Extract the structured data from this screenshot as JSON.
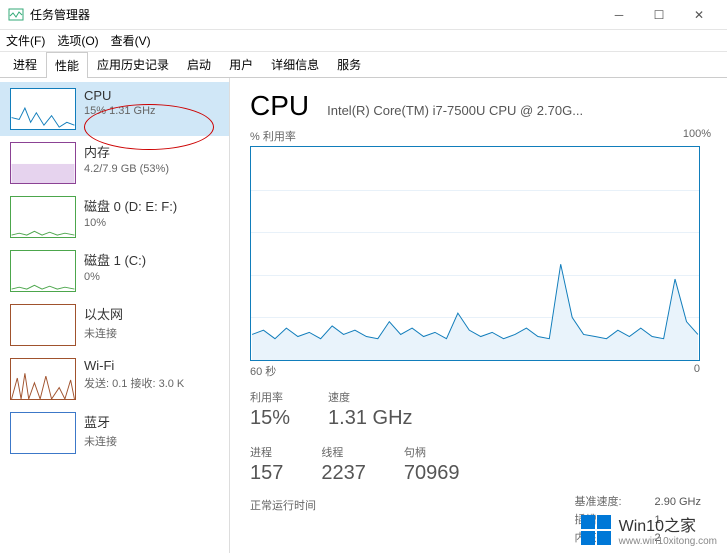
{
  "window": {
    "title": "任务管理器"
  },
  "menu": {
    "file": "文件(F)",
    "options": "选项(O)",
    "view": "查看(V)"
  },
  "tabs": [
    "进程",
    "性能",
    "应用历史记录",
    "启动",
    "用户",
    "详细信息",
    "服务"
  ],
  "active_tab": 1,
  "sidebar": [
    {
      "name": "CPU",
      "sub": "15% 1.31 GHz",
      "kind": "cpu"
    },
    {
      "name": "内存",
      "sub": "4.2/7.9 GB (53%)",
      "kind": "mem"
    },
    {
      "name": "磁盘 0 (D: E: F:)",
      "sub": "10%",
      "kind": "disk"
    },
    {
      "name": "磁盘 1 (C:)",
      "sub": "0%",
      "kind": "disk"
    },
    {
      "name": "以太网",
      "sub": "未连接",
      "kind": "eth"
    },
    {
      "name": "Wi-Fi",
      "sub": "发送: 0.1 接收: 3.0 K",
      "kind": "wifi"
    },
    {
      "name": "蓝牙",
      "sub": "未连接",
      "kind": "bt"
    }
  ],
  "main": {
    "title": "CPU",
    "model": "Intel(R) Core(TM) i7-7500U CPU @ 2.70G...",
    "chart_label_left": "% 利用率",
    "chart_label_right": "100%",
    "chart_bottom_left": "60 秒",
    "chart_bottom_right": "0",
    "stats": [
      {
        "lbl": "利用率",
        "val": "15%"
      },
      {
        "lbl": "速度",
        "val": "1.31 GHz"
      }
    ],
    "stats2": [
      {
        "lbl": "进程",
        "val": "157"
      },
      {
        "lbl": "线程",
        "val": "2237"
      },
      {
        "lbl": "句柄",
        "val": "70969"
      }
    ],
    "specs": [
      {
        "k": "基准速度:",
        "v": "2.90 GHz"
      },
      {
        "k": "插槽:",
        "v": "1"
      },
      {
        "k": "内核:",
        "v": "2"
      }
    ],
    "uptime_label": "正常运行时间"
  },
  "watermark": {
    "brand": "Win10之家",
    "url": "www.win10xitong.com"
  },
  "chart_data": {
    "type": "line",
    "title": "% 利用率",
    "xlabel": "60 秒",
    "ylabel": "% 利用率",
    "ylim": [
      0,
      100
    ],
    "x_range_seconds": [
      60,
      0
    ],
    "values": [
      12,
      14,
      10,
      15,
      11,
      13,
      10,
      16,
      12,
      14,
      11,
      10,
      18,
      12,
      15,
      11,
      13,
      10,
      22,
      14,
      11,
      13,
      10,
      12,
      15,
      11,
      10,
      45,
      20,
      12,
      11,
      10,
      14,
      11,
      15,
      11,
      10,
      38,
      18,
      12
    ]
  }
}
